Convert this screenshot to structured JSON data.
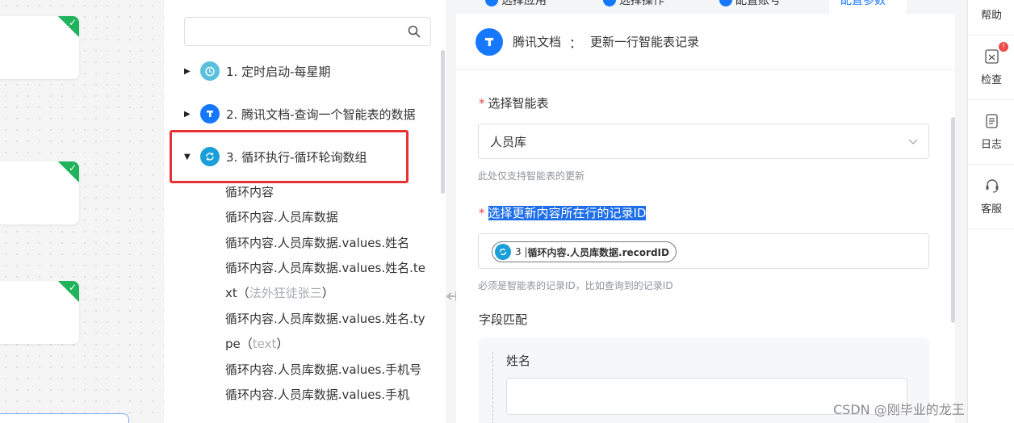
{
  "tree": {
    "search_placeholder": "",
    "nodes": [
      {
        "label": "1. 定时启动-每星期",
        "icon": "alarm-clock-icon"
      },
      {
        "label": "2. 腾讯文档-查询一个智能表的数据",
        "icon": "tencent-docs-icon"
      },
      {
        "label": "3. 循环执行-循环轮询数组",
        "icon": "loop-icon"
      }
    ],
    "children": [
      {
        "text": "循环内容",
        "extra": ""
      },
      {
        "text": "循环内容.人员库数据",
        "extra": ""
      },
      {
        "text": "循环内容.人员库数据.values.姓名",
        "extra": ""
      },
      {
        "text": "循环内容.人员库数据.values.姓名.te",
        "extra": ""
      },
      {
        "text": "xt（",
        "extra": "法外狂徒张三",
        "tail": "）"
      },
      {
        "text": "循环内容.人员库数据.values.姓名.ty",
        "extra": ""
      },
      {
        "text": "pe（",
        "extra": "text",
        "tail": "）"
      },
      {
        "text": "循环内容.人员库数据.values.手机号",
        "extra": ""
      },
      {
        "text": "循环内容.人员库数据.values.手机",
        "extra": ""
      }
    ]
  },
  "config": {
    "tabs": [
      "选择应用",
      "选择操作",
      "配置账号",
      "配置参数"
    ],
    "header": {
      "app": "腾讯文档",
      "separator": "：",
      "action": "更新一行智能表记录"
    },
    "table_label": "选择智能表",
    "table_value": "人员库",
    "table_hint": "此处仅支持智能表的更新",
    "record_label": "选择更新内容所在行的记录ID",
    "record_chip_prefix": "3 | ",
    "record_chip_text": "循环内容.人员库数据.recordID",
    "record_hint": "必须是智能表的记录ID，比如查询到的记录ID",
    "fields_label": "字段匹配",
    "field_name": "姓名",
    "field_value": ""
  },
  "right_bar": {
    "items": [
      {
        "label": "帮助",
        "icon": "help-icon"
      },
      {
        "label": "检查",
        "icon": "check-icon",
        "badge": "!"
      },
      {
        "label": "日志",
        "icon": "log-icon"
      },
      {
        "label": "客服",
        "icon": "headset-icon"
      }
    ]
  },
  "watermark": "CSDN @刚毕业的龙王",
  "colors": {
    "accent": "#1677ff",
    "loop": "#1a9fd8",
    "alarm": "#5bc0de",
    "success": "#1fb35c",
    "highlight": "#e53333"
  }
}
